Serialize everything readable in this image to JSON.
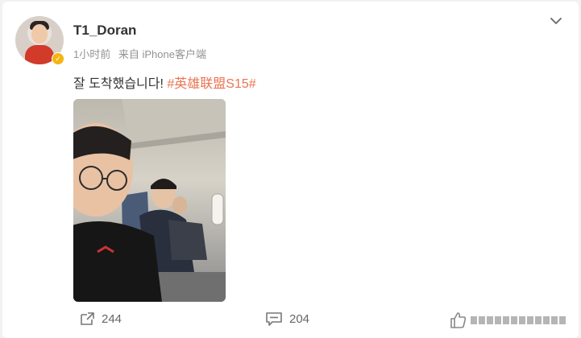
{
  "post": {
    "username": "T1_Doran",
    "time": "1小时前",
    "source": "来自 iPhone客户端",
    "text": "잘 도착했습니다! ",
    "hashtag": "#英雄联盟S15#"
  },
  "actions": {
    "repost_count": "244",
    "comment_count": "204"
  },
  "colors": {
    "hashtag": "#eb7350",
    "verified_badge": "#f5b511"
  },
  "icons": [
    "chevron-down-icon",
    "repost-icon",
    "comment-icon",
    "like-icon",
    "verified-badge-icon"
  ]
}
